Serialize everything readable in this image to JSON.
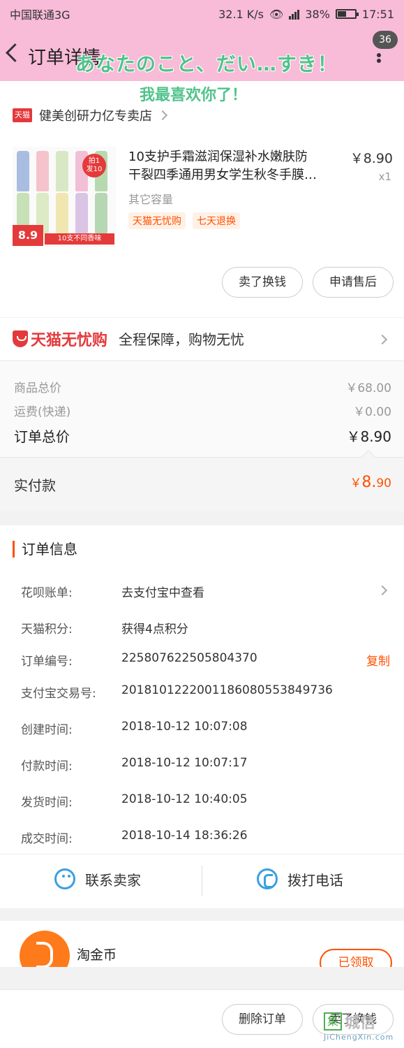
{
  "status": {
    "carrier": "中国联通3G",
    "speed": "32.1 K/s",
    "battery": "38%",
    "time": "17:51"
  },
  "nav": {
    "title": "订单详情",
    "badge": "36"
  },
  "overlay": {
    "line1": "あなたのこと、だい…すき！",
    "line2": "我最喜欢你了！"
  },
  "shop": {
    "platform_badge": "天猫",
    "name": "健美创研力亿专卖店"
  },
  "product": {
    "title_line1": "10支护手霜滋润保湿补水嫩肤防",
    "title_line2": "干裂四季通用男女学生秋冬手膜…",
    "price": "￥8.90",
    "qty": "x1",
    "spec": "其它容量",
    "tags": [
      "天猫无忧购",
      "七天退换"
    ],
    "image_badge_1": "拍1",
    "image_badge_2": "发10",
    "image_price": "8.9",
    "image_banner": "10支不同香味"
  },
  "actions": {
    "sell": "卖了换钱",
    "after_sale": "申请售后"
  },
  "guarantee": {
    "logo": "天猫无忧购",
    "text": "全程保障，购物无忧"
  },
  "pricing": {
    "goods_label": "商品总价",
    "goods_value": "￥68.00",
    "shipping_label": "运费(快递)",
    "shipping_value": "￥0.00",
    "total_label": "订单总价",
    "total_value": "￥8.90",
    "paid_label": "实付款",
    "paid_currency": "￥",
    "paid_int": "8.",
    "paid_dec": "90"
  },
  "order_info": {
    "heading": "订单信息",
    "rows": [
      {
        "key": "花呗账单:",
        "value": "去支付宝中查看"
      },
      {
        "key": "天猫积分:",
        "value": "获得4点积分"
      },
      {
        "key": "订单编号:",
        "value": "225807622505804370",
        "action": "复制"
      },
      {
        "key": "支付宝交易号:",
        "value": "2018101222001186080553849736"
      },
      {
        "key": "创建时间:",
        "value": "2018-10-12 10:07:08"
      },
      {
        "key": "付款时间:",
        "value": "2018-10-12 10:07:17"
      },
      {
        "key": "发货时间:",
        "value": "2018-10-12 10:40:05"
      },
      {
        "key": "成交时间:",
        "value": "2018-10-14 18:36:26"
      }
    ]
  },
  "contact": {
    "seller": "联系卖家",
    "call": "拨打电话"
  },
  "coin": {
    "label": "淘金币",
    "button": "已领取"
  },
  "bottom": {
    "delete": "删除订单",
    "sell": "卖了换钱"
  },
  "watermark": {
    "mark": "集",
    "text": "城信",
    "url": "JiChengXin.com"
  },
  "colors": {
    "accent": "#ff5000",
    "tmall_red": "#e4393c",
    "header_pink": "#f8bbd8",
    "overlay_green": "#4fc38a",
    "icon_blue": "#3aa0e0"
  }
}
